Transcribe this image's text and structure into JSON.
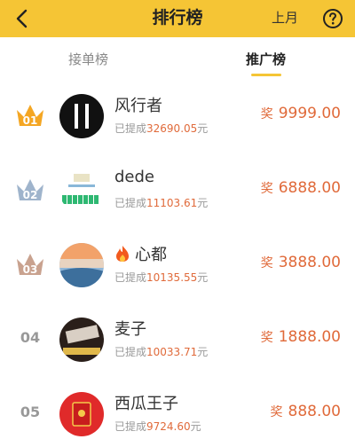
{
  "header": {
    "title": "排行榜",
    "period": "上月"
  },
  "tabs": [
    {
      "label": "接单榜"
    },
    {
      "label": "推广榜"
    }
  ],
  "prize_label": "奖",
  "withdrawn_prefix": "已提成",
  "withdrawn_suffix": "元",
  "rows": [
    {
      "rank": "01",
      "name": "风行者",
      "withdrawn": "32690.05",
      "prize": "9999.00"
    },
    {
      "rank": "02",
      "name": "dede",
      "withdrawn": "11103.61",
      "prize": "6888.00"
    },
    {
      "rank": "03",
      "name": "心都",
      "withdrawn": "10135.55",
      "prize": "3888.00"
    },
    {
      "rank": "04",
      "name": "麦子",
      "withdrawn": "10033.71",
      "prize": "1888.00"
    },
    {
      "rank": "05",
      "name": "西瓜王子",
      "withdrawn": "9724.60",
      "prize": "888.00"
    }
  ],
  "colors": {
    "accent": "#f5c535",
    "prize": "#e06a3a",
    "gold": "#f4a623",
    "silver": "#9fb4cc",
    "bronze": "#c9a28f"
  }
}
